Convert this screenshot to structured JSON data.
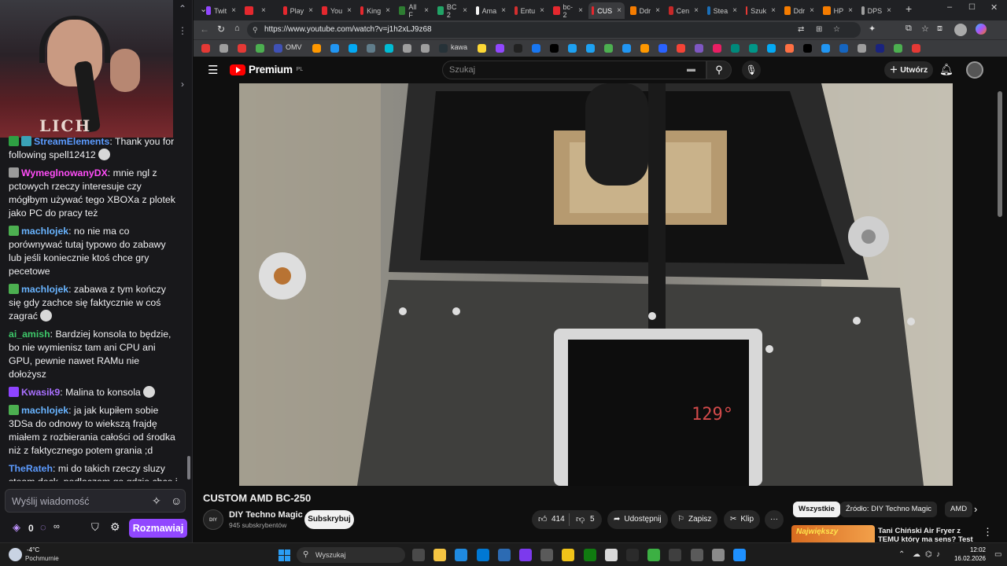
{
  "twitch": {
    "shirt_text": "LICH",
    "chat": [
      {
        "user": "StreamElements",
        "color": "#5c9bff",
        "text": "Thank you for following spell12412",
        "badges": [
          "#2ea043",
          "#3aa3b8"
        ],
        "emote": true
      },
      {
        "user": "WymeglnowanyDX",
        "color": "#ff4df8",
        "text": "mnie ngl z pctowych rzeczy interesuje czy mógłbym używać tego XBOXa z plotek jako PC do pracy też",
        "badges": [
          "#9a9a9a"
        ],
        "emote": false
      },
      {
        "user": "machlojek",
        "color": "#69b4ff",
        "text": "no nie ma co porównywać tutaj typowo do zabawy lub jeśli koniecznie ktoś chce gry pecetowe",
        "badges": [
          "#4caf50"
        ],
        "emote": false
      },
      {
        "user": "machlojek",
        "color": "#69b4ff",
        "text": "zabawa z tym kończy się gdy zachce się faktycznie w coś zagrać",
        "badges": [
          "#4caf50"
        ],
        "emote": true
      },
      {
        "user": "ai_amish",
        "color": "#3ec96a",
        "text": "Bardziej konsola to będzie, bo nie wymienisz tam ani CPU ani GPU, pewnie nawet RAMu nie dołożysz",
        "badges": [],
        "emote": false
      },
      {
        "user": "Kwasik9",
        "color": "#a970ff",
        "text": "Malina to konsola",
        "badges": [
          "#8e44ff"
        ],
        "emote": true
      },
      {
        "user": "machlojek",
        "color": "#69b4ff",
        "text": "ja jak kupiłem sobie 3DSa do odnowy to wiekszą frajdę miałem z rozbierania całości od środka niż z faktycznego potem grania ;d",
        "badges": [
          "#4caf50"
        ],
        "emote": false
      },
      {
        "user": "TheRateh",
        "color": "#5c9bff",
        "text": "mi do takich rzeczy sluzy steam deck, podlaczam go gdzie chce i sobie pykam w indie gierki",
        "badges": [],
        "emote": false
      }
    ],
    "input_placeholder": "Wyślij wiadomość",
    "points": "0",
    "points_infinity": "∞",
    "send_label": "Rozmawiaj"
  },
  "browser": {
    "tabs": [
      {
        "label": "Twit",
        "color": "#9147ff"
      },
      {
        "label": "",
        "color": "#e5282e"
      },
      {
        "label": "Play",
        "color": "#e5282e"
      },
      {
        "label": "You",
        "color": "#e5282e"
      },
      {
        "label": "King",
        "color": "#e5282e"
      },
      {
        "label": "All F",
        "color": "#2e7d32"
      },
      {
        "label": "BC 2",
        "color": "#21a366"
      },
      {
        "label": "Ama",
        "color": "#f4f4f4"
      },
      {
        "label": "Entu",
        "color": "#d32f2f"
      },
      {
        "label": "bc-2",
        "color": "#e5282e"
      },
      {
        "label": "CUS",
        "color": "#e5282e",
        "active": true
      },
      {
        "label": "Ddr",
        "color": "#f57c00"
      },
      {
        "label": "Cen",
        "color": "#c62828"
      },
      {
        "label": "Stea",
        "color": "#1b6fb8"
      },
      {
        "label": "Szuk",
        "color": "#e53935"
      },
      {
        "label": "Ddr",
        "color": "#f57c00"
      },
      {
        "label": "HP",
        "color": "#f57c00"
      },
      {
        "label": "DPS",
        "color": "#9e9e9e"
      }
    ],
    "url": "https://www.youtube.com/watch?v=j1h2xLJ9z68",
    "bookmarks": [
      {
        "color": "#e53935"
      },
      {
        "color": "#9e9e9e"
      },
      {
        "color": "#e53935"
      },
      {
        "color": "#4caf50"
      },
      {
        "color": "#3f51b5",
        "label": "OMV"
      },
      {
        "color": "#ff9800"
      },
      {
        "color": "#2196f3"
      },
      {
        "color": "#03a9f4"
      },
      {
        "color": "#607d8b"
      },
      {
        "color": "#00bcd4"
      },
      {
        "color": "#9e9e9e"
      },
      {
        "color": "#9e9e9e"
      },
      {
        "color": "#263238",
        "label": "kawa"
      },
      {
        "color": "#fdd835"
      },
      {
        "color": "#9147ff"
      },
      {
        "color": "#212121"
      },
      {
        "color": "#1877f2"
      },
      {
        "color": "#000000"
      },
      {
        "color": "#1da1f2"
      },
      {
        "color": "#1da1f2"
      },
      {
        "color": "#4caf50"
      },
      {
        "color": "#2196f3"
      },
      {
        "color": "#ff9800"
      },
      {
        "color": "#2962ff"
      },
      {
        "color": "#f44336"
      },
      {
        "color": "#7e57c2"
      },
      {
        "color": "#e91e63"
      },
      {
        "color": "#00897b"
      },
      {
        "color": "#009688"
      },
      {
        "color": "#03a9f4"
      },
      {
        "color": "#ff7043"
      },
      {
        "color": "#000000"
      },
      {
        "color": "#2196f3"
      },
      {
        "color": "#1565c0"
      },
      {
        "color": "#9e9e9e"
      },
      {
        "color": "#1a237e"
      },
      {
        "color": "#4caf50"
      },
      {
        "color": "#e53935"
      }
    ]
  },
  "youtube": {
    "logo_text": "Premium",
    "logo_badge": "PL",
    "search_placeholder": "Szukaj",
    "create_label": "Utwórz",
    "video": {
      "display_reading": "129°",
      "title": "CUSTOM AMD BC-250"
    },
    "channel": {
      "avatar_text": "DIY",
      "name": "DIY Techno Magic",
      "subs": "945 subskrybentów",
      "subscribe_label": "Subskrybuj"
    },
    "actions": {
      "likes": "414",
      "dislikes": "5",
      "share": "Udostępnij",
      "save": "Zapisz",
      "clip": "Klip",
      "more": "···"
    },
    "chips": [
      "Wszystkie",
      "Źródło: DIY Techno Magic",
      "AMD"
    ],
    "recommendation": {
      "thumb_text": "Największy",
      "title": "Tani Chiński Air Fryer z TEMU który ma sens? Test"
    }
  },
  "taskbar": {
    "weather_temp": "-4°C",
    "weather_desc": "Pochmurnie",
    "search_label": "Wyszukaj",
    "time": "12:02",
    "date": "16.02.2026",
    "apps": [
      {
        "color": "#4a4a4a"
      },
      {
        "color": "#f5c542"
      },
      {
        "color": "#1f8ae0"
      },
      {
        "color": "#0078d4"
      },
      {
        "color": "#2c6bb3"
      },
      {
        "color": "#7c3aed"
      },
      {
        "color": "#5a5a5a"
      },
      {
        "color": "#f0c419"
      },
      {
        "color": "#107c10"
      },
      {
        "color": "#d9d9d9"
      },
      {
        "color": "#2b2b2b"
      },
      {
        "color": "#3cb043"
      },
      {
        "color": "#3f3f3f"
      },
      {
        "color": "#5a5a5a"
      },
      {
        "color": "#8a8a8a"
      },
      {
        "color": "#1e90ff"
      }
    ]
  }
}
